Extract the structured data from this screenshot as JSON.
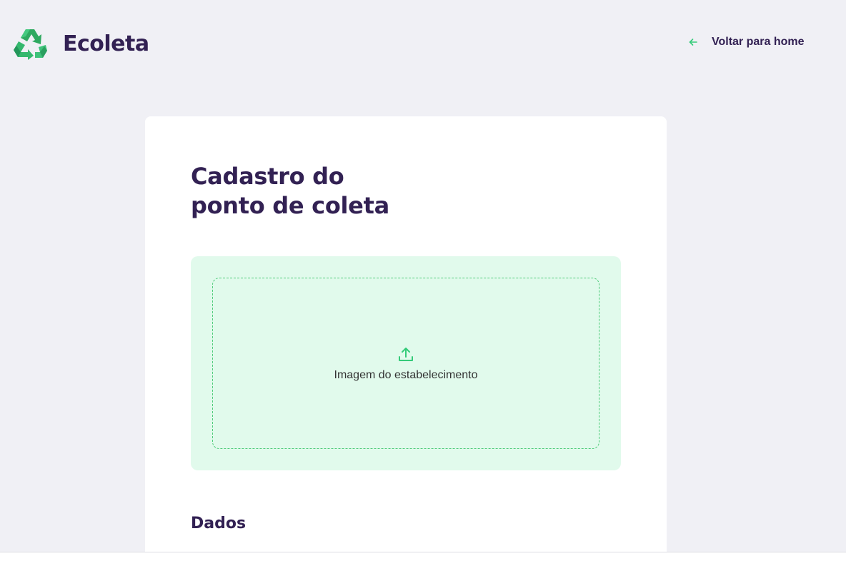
{
  "header": {
    "brand": "Ecoleta",
    "logo_icon": "recycle-icon",
    "back_link": {
      "label": "Voltar para home",
      "icon": "arrow-left-icon"
    }
  },
  "form": {
    "title_line1": "Cadastro do",
    "title_line2": "ponto de coleta",
    "dropzone": {
      "icon": "upload-icon",
      "label": "Imagem do estabelecimento"
    },
    "sections": [
      {
        "title": "Dados"
      }
    ]
  },
  "colors": {
    "brand_dark": "#322153",
    "brand_green": "#34cb79",
    "background": "#f0f0f5",
    "dropzone_bg": "#e1faec"
  }
}
